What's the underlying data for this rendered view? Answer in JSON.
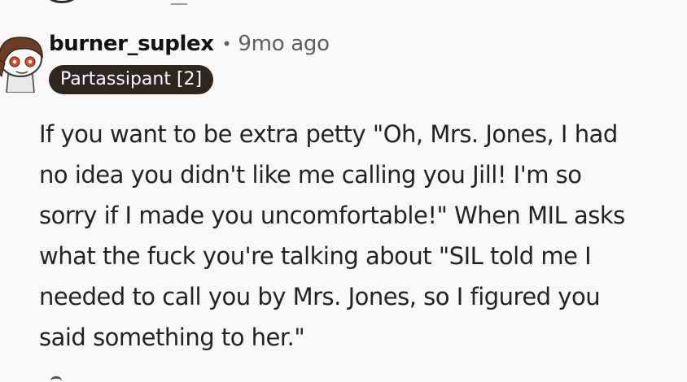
{
  "comment": {
    "author": "burner_suplex",
    "separator": "•",
    "timestamp": "9mo ago",
    "flair": "Partassipant [2]",
    "body_lines": [
      "If you want to be extra petty \"Oh, Mrs. Jones, I had",
      "no idea you didn't like me calling you Jill! I'm so",
      "sorry if I made you uncomfortable!\" When MIL asks",
      "what the fuck you're talking about \"SIL told me I",
      "needed to call you by Mrs. Jones, so I figured you",
      "said something to her.\""
    ]
  },
  "icons": {
    "avatar": "snoo-avatar-icon"
  },
  "colors": {
    "background": "#f9f8f7",
    "flair_background": "#2f2620",
    "flair_text": "#ffffff",
    "meta_text": "#5b5f63",
    "body_text": "#1f2326"
  }
}
